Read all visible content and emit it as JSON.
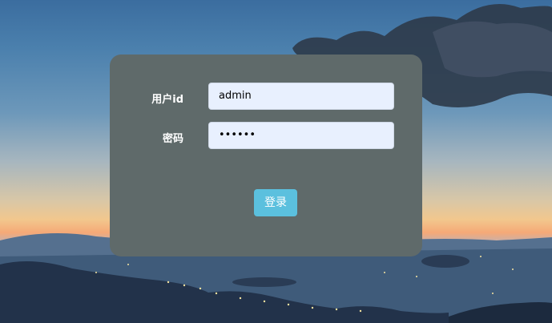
{
  "login_form": {
    "username_label": "用户id",
    "username_value": "admin",
    "password_label": "密码",
    "password_value": "••••••",
    "login_button_label": "登录"
  }
}
